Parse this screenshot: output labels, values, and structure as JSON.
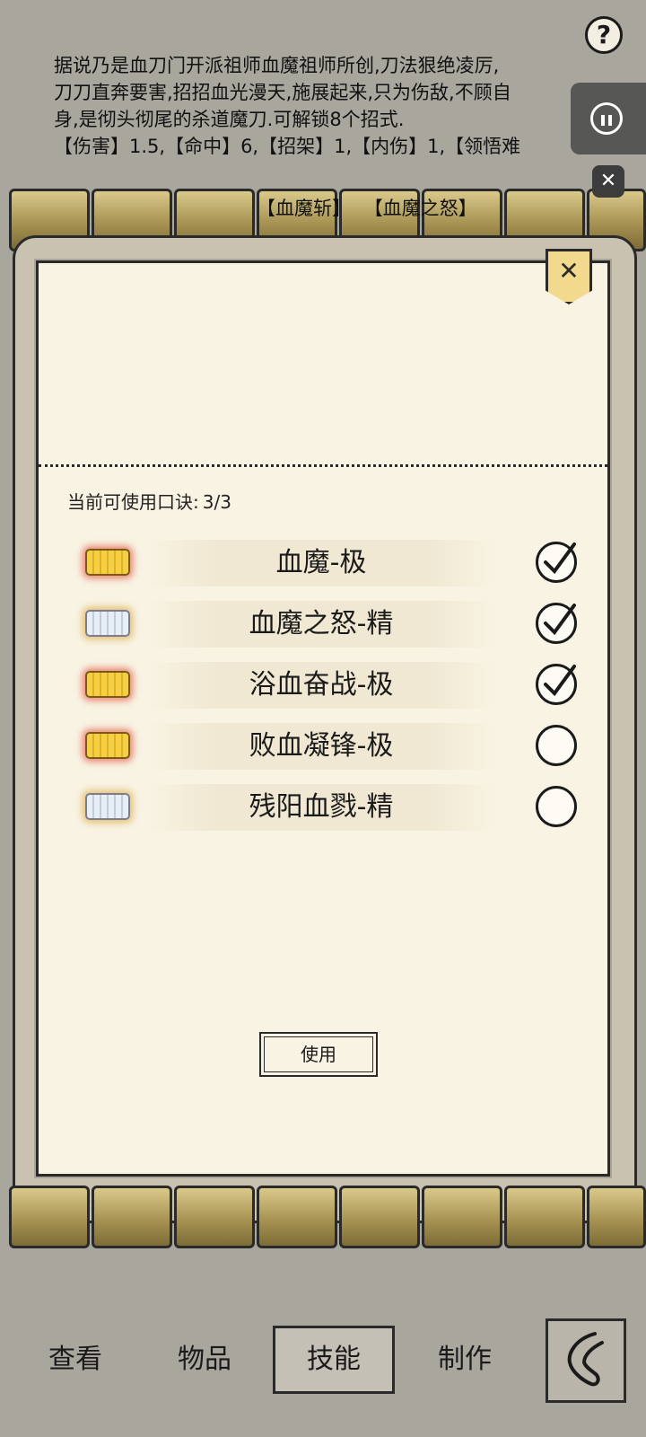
{
  "description_lines": [
    "据说乃是血刀门开派祖师血魔祖师所创,刀法狠绝凌厉,",
    "刀刀直奔要害,招招血光漫天,施展起来,只为伤敌,不顾自",
    "身,是彻头彻尾的杀道魔刀.可解锁8个招式.",
    "【伤害】1.5,【命中】6,【招架】1,【内伤】1,【领悟难"
  ],
  "move_tags": [
    "【血魔斩】",
    "【血魔之怒】"
  ],
  "dialog": {
    "quota_label": "当前可使用口诀:",
    "quota_value": "3/3",
    "skills": [
      {
        "name": "血魔-极",
        "tier": "gold",
        "checked": true
      },
      {
        "name": "血魔之怒-精",
        "tier": "silver",
        "checked": true
      },
      {
        "name": "浴血奋战-极",
        "tier": "gold",
        "checked": true
      },
      {
        "name": "败血凝锋-极",
        "tier": "gold",
        "checked": false
      },
      {
        "name": "残阳血戮-精",
        "tier": "silver",
        "checked": false
      }
    ],
    "use_button": "使用",
    "close_symbol": "✕"
  },
  "overlay": {
    "help_symbol": "?",
    "close_symbol": "✕"
  },
  "bottom_nav": {
    "items": [
      "查看",
      "物品",
      "技能",
      "制作"
    ],
    "active": "技能"
  },
  "colors": {
    "paper": "#f8f3e3",
    "background": "#a9a69e",
    "gold_badge": "#f5d046",
    "silver_badge": "#e8eef8"
  }
}
